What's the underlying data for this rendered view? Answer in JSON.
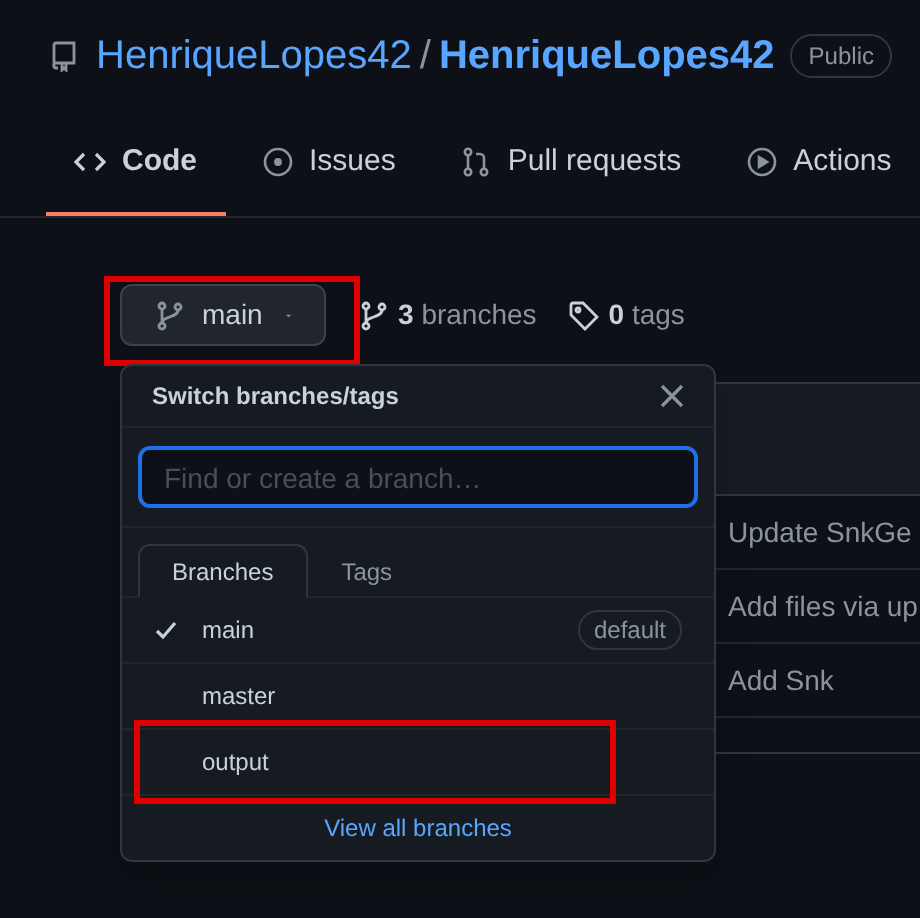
{
  "repo": {
    "owner": "HenriqueLopes42",
    "separator": "/",
    "name": "HenriqueLopes42",
    "visibility": "Public"
  },
  "tabs": [
    {
      "kind": "code",
      "label": "Code",
      "selected": true
    },
    {
      "kind": "issues",
      "label": "Issues",
      "selected": false
    },
    {
      "kind": "pulls",
      "label": "Pull requests",
      "selected": false
    },
    {
      "kind": "actions",
      "label": "Actions",
      "selected": false
    }
  ],
  "branch_button": {
    "label": "main",
    "highlighted": true
  },
  "branches_count": {
    "count": "3",
    "label": "branches"
  },
  "tags_count": {
    "count": "0",
    "label": "tags"
  },
  "commits": [
    "Update SnkGe",
    "Add files via up",
    "Add Snk"
  ],
  "dropdown": {
    "title": "Switch branches/tags",
    "search": {
      "placeholder": "Find or create a branch…"
    },
    "tabs": [
      {
        "label": "Branches",
        "selected": true
      },
      {
        "label": "Tags",
        "selected": false
      }
    ],
    "branches": [
      {
        "name": "main",
        "checked": true,
        "badge": "default",
        "highlighted": false
      },
      {
        "name": "master",
        "checked": false,
        "highlighted": false
      },
      {
        "name": "output",
        "checked": false,
        "highlighted": true
      }
    ],
    "link": "View all branches"
  }
}
